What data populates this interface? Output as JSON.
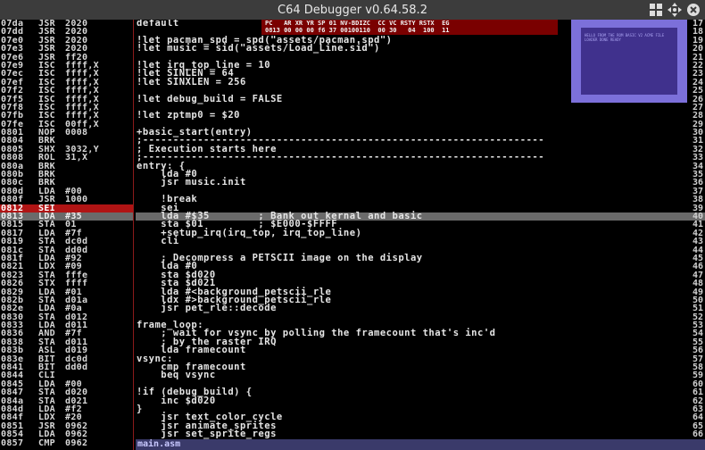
{
  "window": {
    "title": "C64 Debugger v0.64.58.2"
  },
  "disasm": [
    {
      "addr": "07da",
      "mn": "JSR",
      "op": "2020"
    },
    {
      "addr": "07dd",
      "mn": "JSR",
      "op": "2020"
    },
    {
      "addr": "07e0",
      "mn": "JSR",
      "op": "2020"
    },
    {
      "addr": "07e3",
      "mn": "JSR",
      "op": "2020"
    },
    {
      "addr": "07e6",
      "mn": "JSR",
      "op": "ff20"
    },
    {
      "addr": "07e9",
      "mn": "ISC",
      "op": "ffff,X"
    },
    {
      "addr": "07ec",
      "mn": "ISC",
      "op": "ffff,X"
    },
    {
      "addr": "07ef",
      "mn": "ISC",
      "op": "ffff,X"
    },
    {
      "addr": "07f2",
      "mn": "ISC",
      "op": "ffff,X"
    },
    {
      "addr": "07f5",
      "mn": "ISC",
      "op": "ffff,X"
    },
    {
      "addr": "07f8",
      "mn": "ISC",
      "op": "ffff,X"
    },
    {
      "addr": "07fb",
      "mn": "ISC",
      "op": "ffff,X"
    },
    {
      "addr": "07fe",
      "mn": "ISC",
      "op": "00ff,X"
    },
    {
      "addr": "0801",
      "mn": "NOP",
      "op": "0008"
    },
    {
      "addr": "0804",
      "mn": "BRK",
      "op": ""
    },
    {
      "addr": "0805",
      "mn": "SHX",
      "op": "3032,Y"
    },
    {
      "addr": "0808",
      "mn": "ROL",
      "op": "31,X"
    },
    {
      "addr": "080a",
      "mn": "BRK",
      "op": ""
    },
    {
      "addr": "080b",
      "mn": "BRK",
      "op": ""
    },
    {
      "addr": "080c",
      "mn": "BRK",
      "op": ""
    },
    {
      "addr": "080d",
      "mn": "LDA",
      "op": "#00"
    },
    {
      "addr": "080f",
      "mn": "JSR",
      "op": "1000"
    },
    {
      "addr": "0812",
      "mn": "SEI",
      "op": ""
    },
    {
      "addr": "0813",
      "mn": "LDA",
      "op": "#35"
    },
    {
      "addr": "0815",
      "mn": "STA",
      "op": "01"
    },
    {
      "addr": "0817",
      "mn": "LDA",
      "op": "#7f"
    },
    {
      "addr": "0819",
      "mn": "STA",
      "op": "dc0d"
    },
    {
      "addr": "081c",
      "mn": "STA",
      "op": "dd0d"
    },
    {
      "addr": "081f",
      "mn": "LDA",
      "op": "#92"
    },
    {
      "addr": "0821",
      "mn": "LDX",
      "op": "#09"
    },
    {
      "addr": "0823",
      "mn": "STA",
      "op": "fffe"
    },
    {
      "addr": "0826",
      "mn": "STX",
      "op": "ffff"
    },
    {
      "addr": "0829",
      "mn": "LDA",
      "op": "#01"
    },
    {
      "addr": "082b",
      "mn": "STA",
      "op": "d01a"
    },
    {
      "addr": "082e",
      "mn": "LDA",
      "op": "#0a"
    },
    {
      "addr": "0830",
      "mn": "STA",
      "op": "d012"
    },
    {
      "addr": "0833",
      "mn": "LDA",
      "op": "d011"
    },
    {
      "addr": "0836",
      "mn": "AND",
      "op": "#7f"
    },
    {
      "addr": "0838",
      "mn": "STA",
      "op": "d011"
    },
    {
      "addr": "083b",
      "mn": "ASL",
      "op": "d019"
    },
    {
      "addr": "083e",
      "mn": "BIT",
      "op": "dc0d"
    },
    {
      "addr": "0841",
      "mn": "BIT",
      "op": "dd0d"
    },
    {
      "addr": "0844",
      "mn": "CLI",
      "op": ""
    },
    {
      "addr": "0845",
      "mn": "LDA",
      "op": "#00"
    },
    {
      "addr": "0847",
      "mn": "STA",
      "op": "d020"
    },
    {
      "addr": "084a",
      "mn": "STA",
      "op": "d021"
    },
    {
      "addr": "084d",
      "mn": "LDA",
      "op": "#f2"
    },
    {
      "addr": "084f",
      "mn": "LDX",
      "op": "#20"
    },
    {
      "addr": "0851",
      "mn": "JSR",
      "op": "0962"
    },
    {
      "addr": "0854",
      "mn": "LDA",
      "op": "0962"
    },
    {
      "addr": "0857",
      "mn": "CMP",
      "op": "0962"
    }
  ],
  "registers": {
    "header": "PC   AR XR YR SP 01 NV-BDIZC  CC VC RSTY RSTX  EG",
    "values": "0813 00 00 00 f6 37 00100110  00 30   04  100  11"
  },
  "preview_text": "HELLO FROM THE ROM BASIC V2 ACME FILE LOADER DONE READY",
  "source": [
    "default",
    "",
    "!let pacman_spd = spd(\"assets/pacman.spd\")",
    "!let music = sid(\"assets/Load_Line.sid\")",
    "",
    "!let irq_top_line = 10",
    "!let SINLEN = 64",
    "!let SINXLEN = 256",
    "",
    "!let debug_build = FALSE",
    "",
    "!let zptmp0 = $20",
    "",
    "+basic_start(entry)",
    ";------------------------------------------------------------------",
    "; Execution starts here",
    ";------------------------------------------------------------------",
    "entry: {",
    "    lda #0",
    "    jsr music.init",
    "",
    "    !break",
    "    sei",
    "    lda #$35        ; Bank out kernal and basic",
    "    sta $01         ; $E000-$FFFF",
    "    +setup_irq(irq_top, irq_top_line)",
    "    cli",
    "",
    "    ; Decompress a PETSCII image on the display",
    "    lda #0",
    "    sta $d020",
    "    sta $d021",
    "    lda #<background_petscii_rle",
    "    ldx #>background_petscii_rle",
    "    jsr pet_rle::decode",
    "",
    "frame_loop:",
    "    ; wait for vsync by polling the framecount that's inc'd",
    "    ; by the raster IRQ",
    "    lda framecount",
    "vsync:",
    "    cmp framecount",
    "    beq vsync",
    "",
    "!if (debug_build) {",
    "    inc $d020",
    "}",
    "    jsr text_color_cycle",
    "    jsr animate_sprites",
    "    jsr set_sprite_regs"
  ],
  "line_numbers": [
    "17",
    "18",
    "19",
    "20",
    "21",
    "22",
    "23",
    "24",
    "25",
    "26",
    "27",
    "28",
    "29",
    "30",
    "31",
    "32",
    "33",
    "34",
    "35",
    "36",
    "37",
    "38",
    "39",
    "40",
    "41",
    "42",
    "43",
    "44",
    "45",
    "46",
    "47",
    "48",
    "49",
    "50",
    "51",
    "52",
    "53",
    "54",
    "55",
    "56",
    "57",
    "58",
    "59",
    "60",
    "61",
    "62",
    "63",
    "64",
    "65",
    "66"
  ],
  "status": {
    "filename": "main.asm"
  },
  "highlight": {
    "disasm_pc_index": 22,
    "disasm_cur_index": 23,
    "source_cur_index": 23
  },
  "colors": {
    "pc_line": "#b01414",
    "cursor_line": "#6a6a6a",
    "divider": "#8b1a1a",
    "preview_border": "#7c70da",
    "preview_screen": "#40318d"
  }
}
